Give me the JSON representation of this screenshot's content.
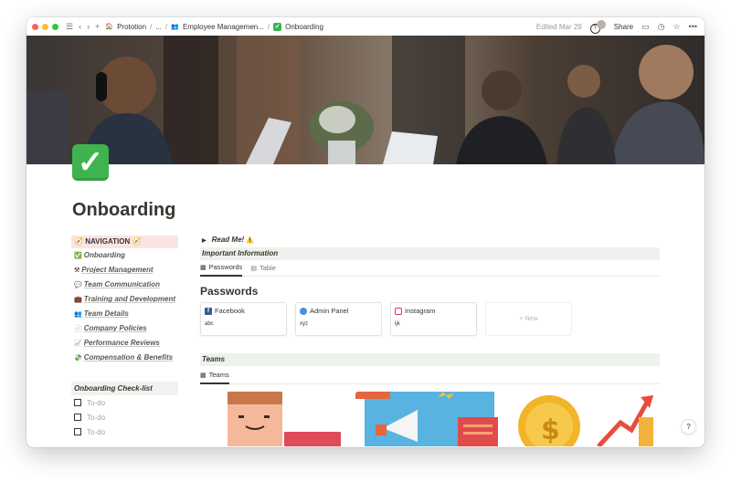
{
  "titlebar": {
    "breadcrumbs": [
      "Prototion",
      "...",
      "Employee Managemen...",
      "Onboarding"
    ],
    "separator": "/",
    "edited": "Edited Mar 29",
    "avatar_initial": "T",
    "share_label": "Share"
  },
  "page": {
    "icon": "✓",
    "title": "Onboarding"
  },
  "navigation": {
    "heading": "NAVIGATION",
    "items": [
      {
        "icon": "✅",
        "label": "Onboarding"
      },
      {
        "icon": "⚒",
        "label": "Project Management"
      },
      {
        "icon": "💬",
        "label": "Team Communication"
      },
      {
        "icon": "💼",
        "label": "Training and Development"
      },
      {
        "icon": "👥",
        "label": "Team Details"
      },
      {
        "icon": "📄",
        "label": "Company Policies"
      },
      {
        "icon": "📈",
        "label": "Performance Reviews"
      },
      {
        "icon": "💸",
        "label": "Compensation & Benefits"
      }
    ]
  },
  "checklist": {
    "heading": "Onboarding Check-list",
    "items": [
      "To-do",
      "To-do",
      "To-do"
    ]
  },
  "main": {
    "toggle_label": "Read Me!",
    "important_label": "Important Information",
    "tabs": [
      {
        "label": "Passwords"
      },
      {
        "label": "Table"
      }
    ],
    "passwords_heading": "Passwords",
    "cards": [
      {
        "title": "Facebook",
        "value": "abc"
      },
      {
        "title": "Admin Panel",
        "value": "xyz"
      },
      {
        "title": "Instagram",
        "value": "ijk"
      }
    ],
    "new_label": "+ New",
    "teams_label": "Teams",
    "teams_tab": "Teams"
  },
  "help_label": "?"
}
